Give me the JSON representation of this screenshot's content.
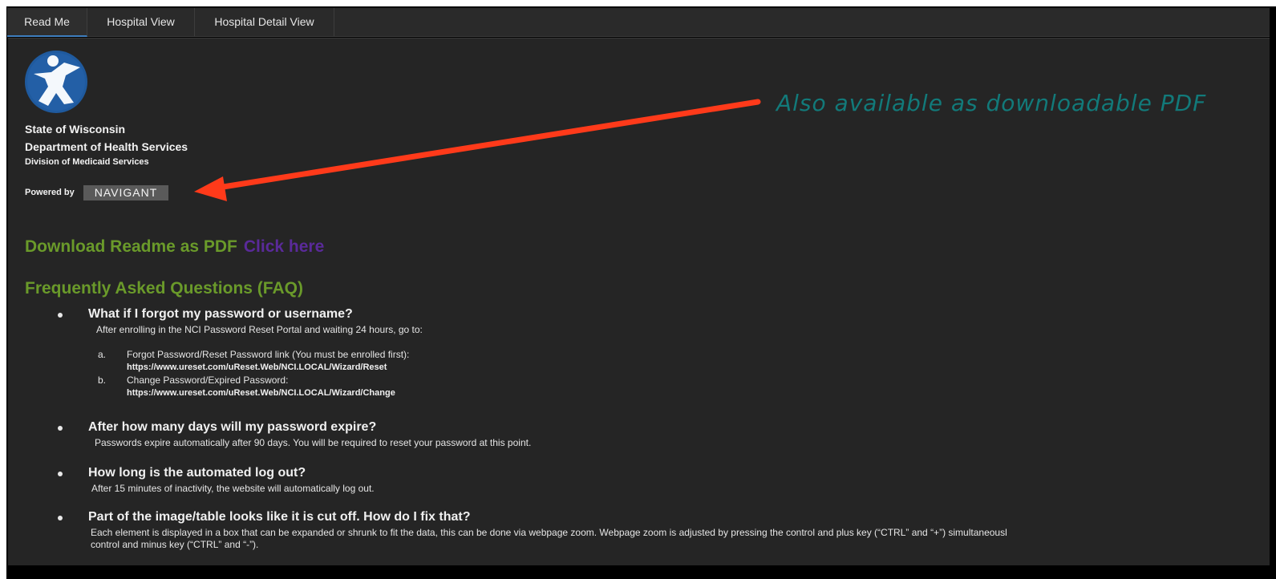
{
  "tabs": [
    {
      "label": "Read Me",
      "active": true
    },
    {
      "label": "Hospital View",
      "active": false
    },
    {
      "label": "Hospital Detail View",
      "active": false
    }
  ],
  "org": {
    "line1": "State of Wisconsin",
    "line2": "Department of Health Services",
    "line3": "Division of Medicaid Services",
    "powered_by": "Powered by",
    "navigant": "NAVIGANT"
  },
  "annotation": "Also available as downloadable PDF",
  "download": {
    "label": "Download Readme as PDF",
    "link": "Click here"
  },
  "faq": {
    "heading": "Frequently Asked Questions (FAQ)",
    "q1": {
      "question": "What if I forgot my password or username?",
      "answer": "After enrolling in the NCI Password Reset Portal and waiting 24 hours, go to:",
      "a_label": "a.",
      "a_text": "Forgot Password/Reset Password link (You must be enrolled first):",
      "a_url": "https://www.ureset.com/uReset.Web/NCI.LOCAL/Wizard/Reset",
      "b_label": "b.",
      "b_text": "Change Password/Expired Password:",
      "b_url": "https://www.ureset.com/uReset.Web/NCI.LOCAL/Wizard/Change"
    },
    "q2": {
      "question": "After how many days will my password expire?",
      "answer": "Passwords expire automatically after 90 days. You will be required to reset your password at this point."
    },
    "q3": {
      "question": "How long is the automated log out?",
      "answer": "After 15 minutes of inactivity, the website will automatically log out."
    },
    "q4": {
      "question": "Part of the image/table looks like it is cut off.  How do I fix that?",
      "answer_line1": "Each element is displayed in a box that can be expanded or shrunk to fit the data, this can be done via webpage zoom.  Webpage zoom is adjusted by pressing the control and plus key (“CTRL” and “+”) simultaneousl",
      "answer_line2": "control and minus key (“CTRL” and “-”)."
    }
  },
  "colors": {
    "background": "#252525",
    "heading_green": "#6a9a2a",
    "link_purple": "#5a2a9a",
    "annotation_teal": "#127a7a",
    "arrow_red": "#ff3a1a",
    "tab_active_underline": "#3f7fbf"
  },
  "icons": {
    "logo": "wi-dhs-figure-icon"
  }
}
